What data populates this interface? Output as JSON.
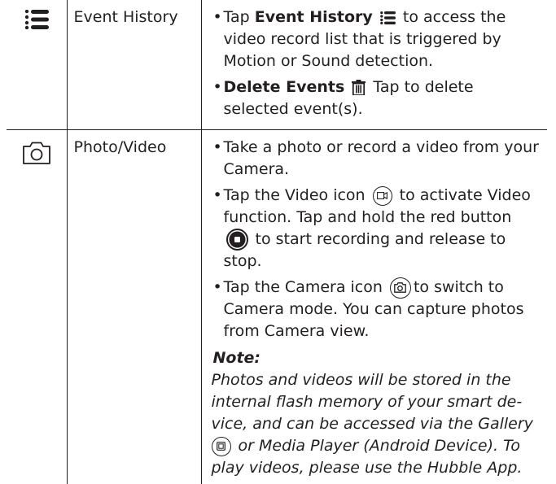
{
  "rows": [
    {
      "icon": "event-list-icon",
      "feature": "Event History",
      "bullets": [
        {
          "pre": "Tap ",
          "bold": "Event History",
          "post": " to access the video record list that is triggered by Motion or Sound detection."
        },
        {
          "bold": "Delete Events",
          "post": "  Tap to delete selected event(s)."
        }
      ]
    },
    {
      "icon": "camera-outline-icon",
      "feature": "Photo/Video",
      "bullets": [
        {
          "text": "Take a photo or record a video from your Camera."
        },
        {
          "pre": "Tap the Video icon ",
          "post": " to activate Video function. Tap and hold the red button ",
          "post2": " to start recording and release to stop."
        },
        {
          "pre": "Tap the Camera icon ",
          "post": "to switch to Camera mode. You can capture photos from Camera view."
        }
      ],
      "note_heading": "Note:",
      "note_pre": "Photos and videos will be stored in the internal flash memory of your smart de-vice, and can be accessed via the Gallery ",
      "note_post": " or Media Player (Android Device). To play videos, please use the Hubble App."
    }
  ],
  "icons": {
    "list": "list-icon",
    "trash": "trash-icon",
    "video": "video-icon",
    "record": "record-button-icon",
    "camera": "camera-icon",
    "gallery": "gallery-icon"
  }
}
